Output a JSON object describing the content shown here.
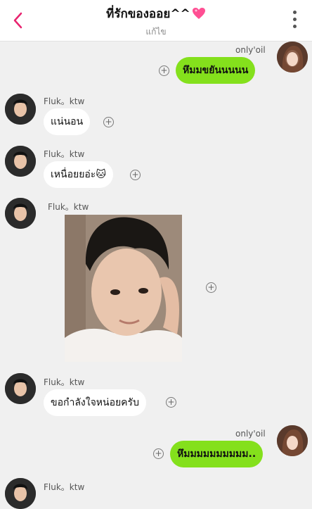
{
  "header": {
    "title": "ที่รักของออย^^",
    "subtitle": "แก้ไข",
    "back_icon": "chevron-left-icon",
    "more_icon": "more-vertical-icon",
    "accent": "#e8236f"
  },
  "messages": [
    {
      "sender": "only'oil",
      "text": "หึมมขยันนนนน",
      "side": "out"
    },
    {
      "sender": "Fluk。ktw",
      "text": "แน่นอน",
      "side": "in"
    },
    {
      "sender": "Fluk。ktw",
      "text": "เหนื่อยยอ่ะ",
      "emoji": "🐱",
      "side": "in"
    },
    {
      "sender": "Fluk。ktw",
      "image": "selfie-photo",
      "side": "in"
    },
    {
      "sender": "Fluk。ktw",
      "text": "ขอกำลังใจหน่อยครับ",
      "side": "in"
    },
    {
      "sender": "only'oil",
      "text": "หึมมมมมมมมมม..",
      "side": "out"
    },
    {
      "sender": "Fluk。ktw",
      "side": "in"
    }
  ],
  "colors": {
    "outgoing_bubble": "#84e01c",
    "incoming_bubble": "#ffffff",
    "background": "#f0f0f0"
  }
}
